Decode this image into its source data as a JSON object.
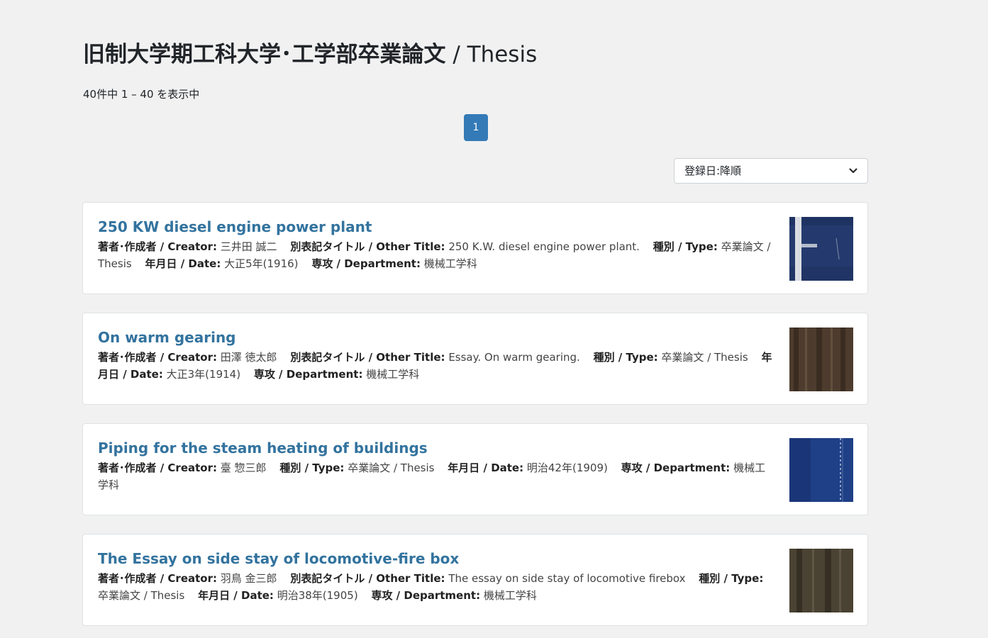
{
  "page": {
    "title_jp": "旧制大学期工科大学･工学部卒業論文",
    "title_sep": " / ",
    "title_en": "Thesis",
    "result_count": "40件中 1 – 40 を表示中"
  },
  "pagination": {
    "current": "1"
  },
  "sort": {
    "label": "登録日:降順"
  },
  "labels": {
    "creator": "著者･作成者 / Creator:",
    "other_title": "別表記タイトル / Other Title:",
    "type": "種別 / Type:",
    "date": "年月日 / Date:",
    "department": "専攻 / Department:"
  },
  "records": [
    {
      "title": "250 KW diesel engine power plant",
      "creator": "三井田 誠二",
      "other_title": "250 K.W. diesel engine power plant.",
      "type": "卒業論文 / Thesis",
      "date": "大正5年(1916)",
      "department": "機械工学科",
      "thumb_colors": [
        "#243a6e",
        "#1c2f5c",
        "#d9dde2"
      ]
    },
    {
      "title": "On warm gearing",
      "creator": "田澤 徳太郎",
      "other_title": "Essay. On warm gearing.",
      "type": "卒業論文 / Thesis",
      "date": "大正3年(1914)",
      "department": "機械工学科",
      "thumb_colors": [
        "#4d3c2e",
        "#3b2c21",
        "#6b5743"
      ]
    },
    {
      "title": "Piping for the steam heating of buildings",
      "creator": "臺 惣三郎",
      "type": "卒業論文 / Thesis",
      "date": "明治42年(1909)",
      "department": "機械工学科",
      "thumb_colors": [
        "#1f3f86",
        "#183372",
        "#8fa2c8"
      ]
    },
    {
      "title": "The Essay on side stay of locomotive-fire box",
      "creator": "羽鳥 金三郎",
      "other_title": "The essay on side stay of locomotive firebox",
      "type": "卒業論文 / Thesis",
      "date": "明治38年(1905)",
      "department": "機械工学科",
      "thumb_colors": [
        "#4a4233",
        "#363024",
        "#6a604b"
      ]
    }
  ]
}
